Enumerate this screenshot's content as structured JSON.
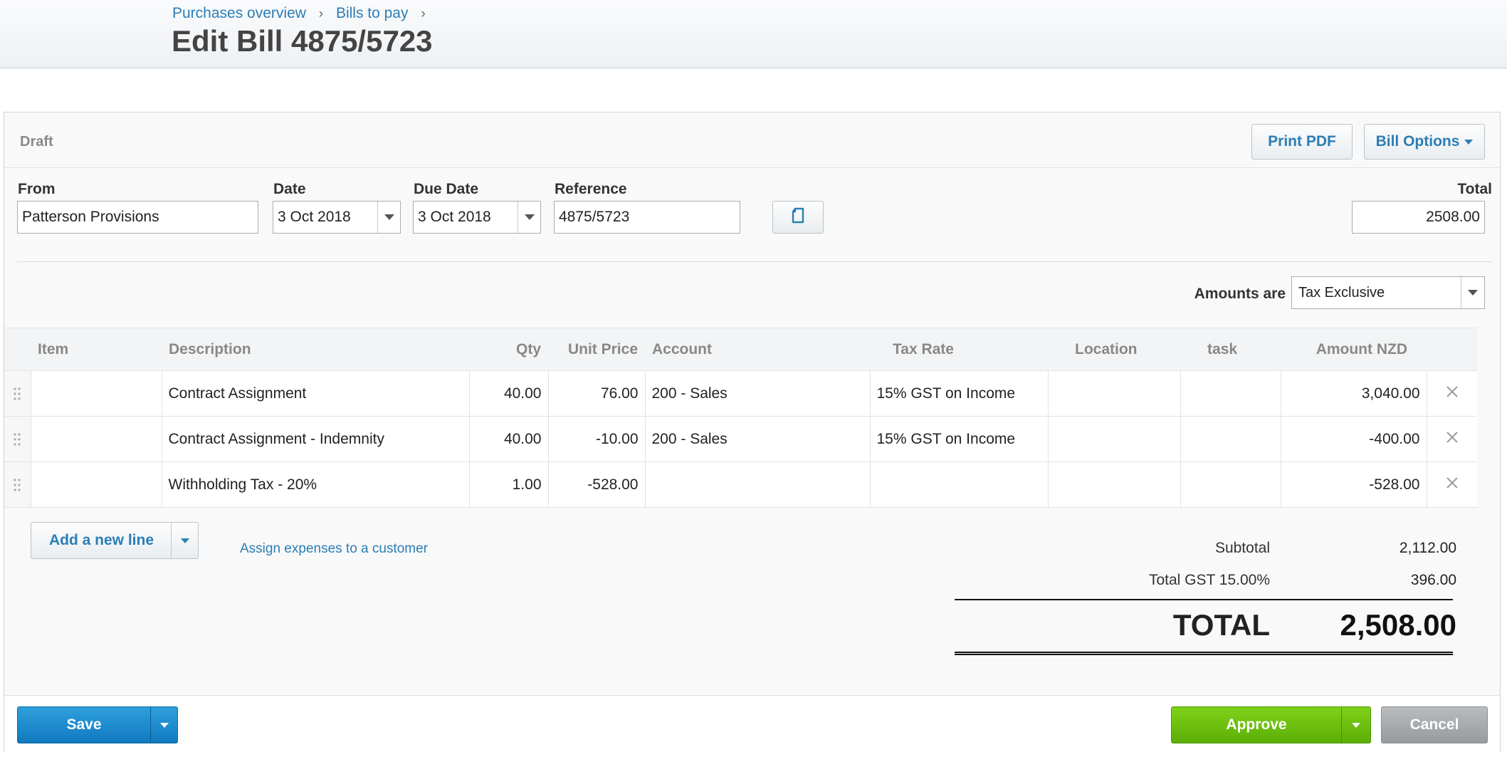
{
  "breadcrumb": {
    "items": [
      "Purchases overview",
      "Bills to pay"
    ],
    "separator": "›"
  },
  "page": {
    "title": "Edit Bill 4875/5723"
  },
  "status": {
    "label": "Draft"
  },
  "toolbar": {
    "print_pdf": "Print PDF",
    "bill_options": "Bill Options"
  },
  "form": {
    "from_label": "From",
    "from_value": "Patterson Provisions",
    "date_label": "Date",
    "date_value": "3 Oct 2018",
    "due_date_label": "Due Date",
    "due_date_value": "3 Oct 2018",
    "reference_label": "Reference",
    "reference_value": "4875/5723",
    "total_label": "Total",
    "total_value": "2508.00",
    "amounts_are_label": "Amounts are",
    "amounts_are_value": "Tax Exclusive"
  },
  "table": {
    "headers": [
      "Item",
      "Description",
      "Qty",
      "Unit Price",
      "Account",
      "Tax Rate",
      "Location",
      "task",
      "Amount NZD"
    ],
    "rows": [
      {
        "item": "",
        "description": "Contract Assignment",
        "qty": "40.00",
        "unit_price": "76.00",
        "account": "200 - Sales",
        "tax_rate": "15% GST on Income",
        "location": "",
        "task": "",
        "amount": "3,040.00"
      },
      {
        "item": "",
        "description": "Contract Assignment - Indemnity",
        "qty": "40.00",
        "unit_price": "-10.00",
        "account": "200 - Sales",
        "tax_rate": "15% GST on Income",
        "location": "",
        "task": "",
        "amount": "-400.00"
      },
      {
        "item": "",
        "description": "Withholding Tax - 20%",
        "qty": "1.00",
        "unit_price": "-528.00",
        "account": "",
        "tax_rate": "",
        "location": "",
        "task": "",
        "amount": "-528.00"
      }
    ]
  },
  "actions": {
    "add_line": "Add a new line",
    "assign_expenses": "Assign expenses to a customer"
  },
  "totals": {
    "subtotal_label": "Subtotal",
    "subtotal_value": "2,112.00",
    "gst_label": "Total GST 15.00%",
    "gst_value": "396.00",
    "total_label": "TOTAL",
    "total_value": "2,508.00"
  },
  "footer": {
    "save": "Save",
    "approve": "Approve",
    "cancel": "Cancel"
  },
  "colors": {
    "link": "#2b7eb5",
    "save": "#1a8ad0",
    "approve": "#6cc20f",
    "cancel": "#a8acaf"
  },
  "icons": {
    "delete": "close-icon",
    "drag": "drag-handle-icon",
    "copy": "copy-document-icon",
    "dropdown": "chevron-down-icon"
  }
}
